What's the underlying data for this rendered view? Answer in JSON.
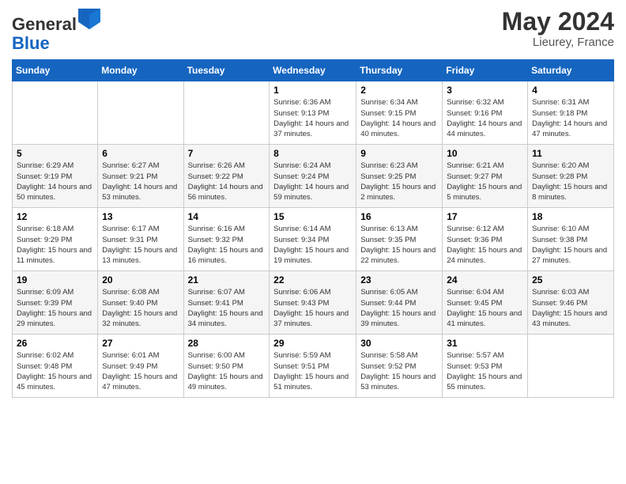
{
  "header": {
    "logo_general": "General",
    "logo_blue": "Blue",
    "month_title": "May 2024",
    "location": "Lieurey, France"
  },
  "days_of_week": [
    "Sunday",
    "Monday",
    "Tuesday",
    "Wednesday",
    "Thursday",
    "Friday",
    "Saturday"
  ],
  "weeks": [
    [
      {
        "day": "",
        "content": ""
      },
      {
        "day": "",
        "content": ""
      },
      {
        "day": "",
        "content": ""
      },
      {
        "day": "1",
        "content": "Sunrise: 6:36 AM\nSunset: 9:13 PM\nDaylight: 14 hours\nand 37 minutes."
      },
      {
        "day": "2",
        "content": "Sunrise: 6:34 AM\nSunset: 9:15 PM\nDaylight: 14 hours\nand 40 minutes."
      },
      {
        "day": "3",
        "content": "Sunrise: 6:32 AM\nSunset: 9:16 PM\nDaylight: 14 hours\nand 44 minutes."
      },
      {
        "day": "4",
        "content": "Sunrise: 6:31 AM\nSunset: 9:18 PM\nDaylight: 14 hours\nand 47 minutes."
      }
    ],
    [
      {
        "day": "5",
        "content": "Sunrise: 6:29 AM\nSunset: 9:19 PM\nDaylight: 14 hours\nand 50 minutes."
      },
      {
        "day": "6",
        "content": "Sunrise: 6:27 AM\nSunset: 9:21 PM\nDaylight: 14 hours\nand 53 minutes."
      },
      {
        "day": "7",
        "content": "Sunrise: 6:26 AM\nSunset: 9:22 PM\nDaylight: 14 hours\nand 56 minutes."
      },
      {
        "day": "8",
        "content": "Sunrise: 6:24 AM\nSunset: 9:24 PM\nDaylight: 14 hours\nand 59 minutes."
      },
      {
        "day": "9",
        "content": "Sunrise: 6:23 AM\nSunset: 9:25 PM\nDaylight: 15 hours\nand 2 minutes."
      },
      {
        "day": "10",
        "content": "Sunrise: 6:21 AM\nSunset: 9:27 PM\nDaylight: 15 hours\nand 5 minutes."
      },
      {
        "day": "11",
        "content": "Sunrise: 6:20 AM\nSunset: 9:28 PM\nDaylight: 15 hours\nand 8 minutes."
      }
    ],
    [
      {
        "day": "12",
        "content": "Sunrise: 6:18 AM\nSunset: 9:29 PM\nDaylight: 15 hours\nand 11 minutes."
      },
      {
        "day": "13",
        "content": "Sunrise: 6:17 AM\nSunset: 9:31 PM\nDaylight: 15 hours\nand 13 minutes."
      },
      {
        "day": "14",
        "content": "Sunrise: 6:16 AM\nSunset: 9:32 PM\nDaylight: 15 hours\nand 16 minutes."
      },
      {
        "day": "15",
        "content": "Sunrise: 6:14 AM\nSunset: 9:34 PM\nDaylight: 15 hours\nand 19 minutes."
      },
      {
        "day": "16",
        "content": "Sunrise: 6:13 AM\nSunset: 9:35 PM\nDaylight: 15 hours\nand 22 minutes."
      },
      {
        "day": "17",
        "content": "Sunrise: 6:12 AM\nSunset: 9:36 PM\nDaylight: 15 hours\nand 24 minutes."
      },
      {
        "day": "18",
        "content": "Sunrise: 6:10 AM\nSunset: 9:38 PM\nDaylight: 15 hours\nand 27 minutes."
      }
    ],
    [
      {
        "day": "19",
        "content": "Sunrise: 6:09 AM\nSunset: 9:39 PM\nDaylight: 15 hours\nand 29 minutes."
      },
      {
        "day": "20",
        "content": "Sunrise: 6:08 AM\nSunset: 9:40 PM\nDaylight: 15 hours\nand 32 minutes."
      },
      {
        "day": "21",
        "content": "Sunrise: 6:07 AM\nSunset: 9:41 PM\nDaylight: 15 hours\nand 34 minutes."
      },
      {
        "day": "22",
        "content": "Sunrise: 6:06 AM\nSunset: 9:43 PM\nDaylight: 15 hours\nand 37 minutes."
      },
      {
        "day": "23",
        "content": "Sunrise: 6:05 AM\nSunset: 9:44 PM\nDaylight: 15 hours\nand 39 minutes."
      },
      {
        "day": "24",
        "content": "Sunrise: 6:04 AM\nSunset: 9:45 PM\nDaylight: 15 hours\nand 41 minutes."
      },
      {
        "day": "25",
        "content": "Sunrise: 6:03 AM\nSunset: 9:46 PM\nDaylight: 15 hours\nand 43 minutes."
      }
    ],
    [
      {
        "day": "26",
        "content": "Sunrise: 6:02 AM\nSunset: 9:48 PM\nDaylight: 15 hours\nand 45 minutes."
      },
      {
        "day": "27",
        "content": "Sunrise: 6:01 AM\nSunset: 9:49 PM\nDaylight: 15 hours\nand 47 minutes."
      },
      {
        "day": "28",
        "content": "Sunrise: 6:00 AM\nSunset: 9:50 PM\nDaylight: 15 hours\nand 49 minutes."
      },
      {
        "day": "29",
        "content": "Sunrise: 5:59 AM\nSunset: 9:51 PM\nDaylight: 15 hours\nand 51 minutes."
      },
      {
        "day": "30",
        "content": "Sunrise: 5:58 AM\nSunset: 9:52 PM\nDaylight: 15 hours\nand 53 minutes."
      },
      {
        "day": "31",
        "content": "Sunrise: 5:57 AM\nSunset: 9:53 PM\nDaylight: 15 hours\nand 55 minutes."
      },
      {
        "day": "",
        "content": ""
      }
    ]
  ]
}
